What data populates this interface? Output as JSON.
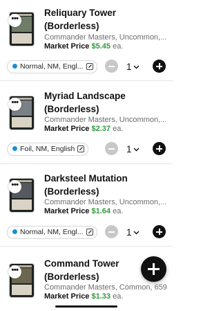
{
  "cards": [
    {
      "name_line1": "Reliquary Tower",
      "name_line2": "(Borderless)",
      "meta": "Commander Masters, Uncommon,...",
      "price_label": "Market Price",
      "price_value": "$5.45",
      "price_unit": "ea.",
      "chip_label": "Normal, NM, Engl...",
      "quantity": "1"
    },
    {
      "name_line1": "Myriad Landscape",
      "name_line2": "(Borderless)",
      "meta": "Commander Masters, Uncommon,...",
      "price_label": "Market Price",
      "price_value": "$2.37",
      "price_unit": "ea.",
      "chip_label": "Foil, NM, English",
      "quantity": "1"
    },
    {
      "name_line1": "Darksteel Mutation",
      "name_line2": "(Borderless)",
      "meta": "Commander Masters, Uncommon,...",
      "price_label": "Market Price",
      "price_value": "$1.64",
      "price_unit": "ea.",
      "chip_label": "Normal, NM, Engl...",
      "quantity": "1"
    },
    {
      "name_line1": "Command Tower",
      "name_line2": "(Borderless)",
      "meta": "Commander Masters, Common, 659",
      "price_label": "Market Price",
      "price_value": "$1.33",
      "price_unit": "ea.",
      "chip_label": "",
      "quantity": ""
    }
  ],
  "more_glyph": "•••",
  "colors": {
    "price_green": "#2f9a3c",
    "chip_dot_blue": "#1a8fd1",
    "fab_black": "#111111"
  },
  "icons": {
    "more": "more-options-icon",
    "edit": "edit-icon",
    "minus": "minus-icon",
    "plus": "plus-icon",
    "chevron": "chevron-down-icon"
  }
}
